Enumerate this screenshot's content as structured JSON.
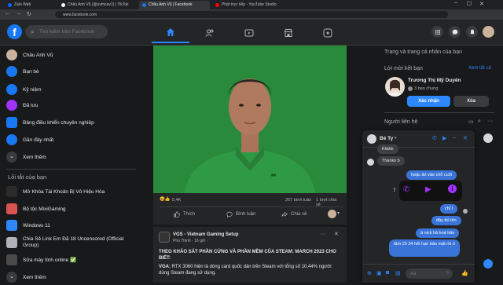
{
  "browser": {
    "tabs": [
      {
        "label": "Zalo Web",
        "color": "#0068ff"
      },
      {
        "label": "Châu Anh Vũ (@uvmcav1) | TikTok",
        "color": "#ffffff"
      },
      {
        "label": "Châu Anh Vũ | Facebook",
        "color": "#1877f2"
      },
      {
        "label": "Phát trực tiếp - YouTube Studio",
        "color": "#ff0000"
      }
    ],
    "url": "www.facebook.com"
  },
  "header": {
    "logo": "f",
    "search_placeholder": "Tìm kiếm trên Facebook"
  },
  "left_sidebar": {
    "items": [
      {
        "label": "Châu Anh Vũ",
        "color": "#c9b39a"
      },
      {
        "label": "Bạn bè",
        "color": "#1877f2"
      },
      {
        "label": "Kỷ niệm",
        "color": "#1877f2"
      },
      {
        "label": "Đã lưu",
        "color": "#a033ff"
      },
      {
        "label": "Bảng điều khiển chuyên nghiệp",
        "color": "#1877f2"
      },
      {
        "label": "Gần đây nhất",
        "color": "#1877f2"
      },
      {
        "label": "Xem thêm",
        "color": "#3a3b3c"
      }
    ],
    "shortcuts_title": "Lối tắt của bạn",
    "shortcuts": [
      {
        "label": "Mở Khóa Tài Khoản Bị Vô Hiệu Hóa",
        "color": "#2b2b2b"
      },
      {
        "label": "Bộ tộc MixiGaming",
        "color": "#d9534f"
      },
      {
        "label": "Windows 11",
        "color": "#2d88ff"
      },
      {
        "label": "Chia Sẻ Link Em Đã 18 Uncensored (Official Group)",
        "color": "#b0b3b8"
      },
      {
        "label": "Sửa máy tính online ✅",
        "color": "#4a4a4a"
      },
      {
        "label": "Xem thêm",
        "color": "#3a3b3c"
      }
    ]
  },
  "post1": {
    "reactions": "5,4K",
    "comments": "267 bình luận",
    "shares": "1 lượt chia sẻ",
    "like_label": "Thích",
    "comment_label": "Bình luận",
    "share_label": "Chia sẻ"
  },
  "post2": {
    "page_name": "VGS - Vietnam Gaming Setup",
    "meta": "Phú Thịnh · 16 giờ ·",
    "headline": "THEO KHẢO SÁT PHẦN CỨNG VÀ PHẦN MỀM CỦA STEAM: MARCH 2023 CHO BIẾT:",
    "body_bold": "VGA:",
    "body": " RTX 3060 hiện là dòng card quốc dân trên Steam với tổng số 10,44% người dùng Steam đang sử dụng."
  },
  "right_sidebar": {
    "pages_title": "Trang và trang cá nhân của bạn",
    "requests_title": "Lời mời kết bạn",
    "see_all": "Xem tất cả",
    "request_name": "Trương Thị Mỹ Duyên",
    "mutual": "3 bạn chung",
    "confirm_label": "Xác nhận",
    "delete_label": "Xóa",
    "contacts_title": "Người liên hệ"
  },
  "chat": {
    "name": "Bé Ty",
    "messages_in": [
      "Kkkkk",
      "Thanks b"
    ],
    "messages_out": [
      "hoặc ăn vào chỗ cuối",
      "chỉ I",
      "đây đủ tên",
      "à nick hả hoá hãn",
      "tâm 23 24 hết hạn bảo mật rồi ó"
    ],
    "input_placeholder": "Aa"
  }
}
